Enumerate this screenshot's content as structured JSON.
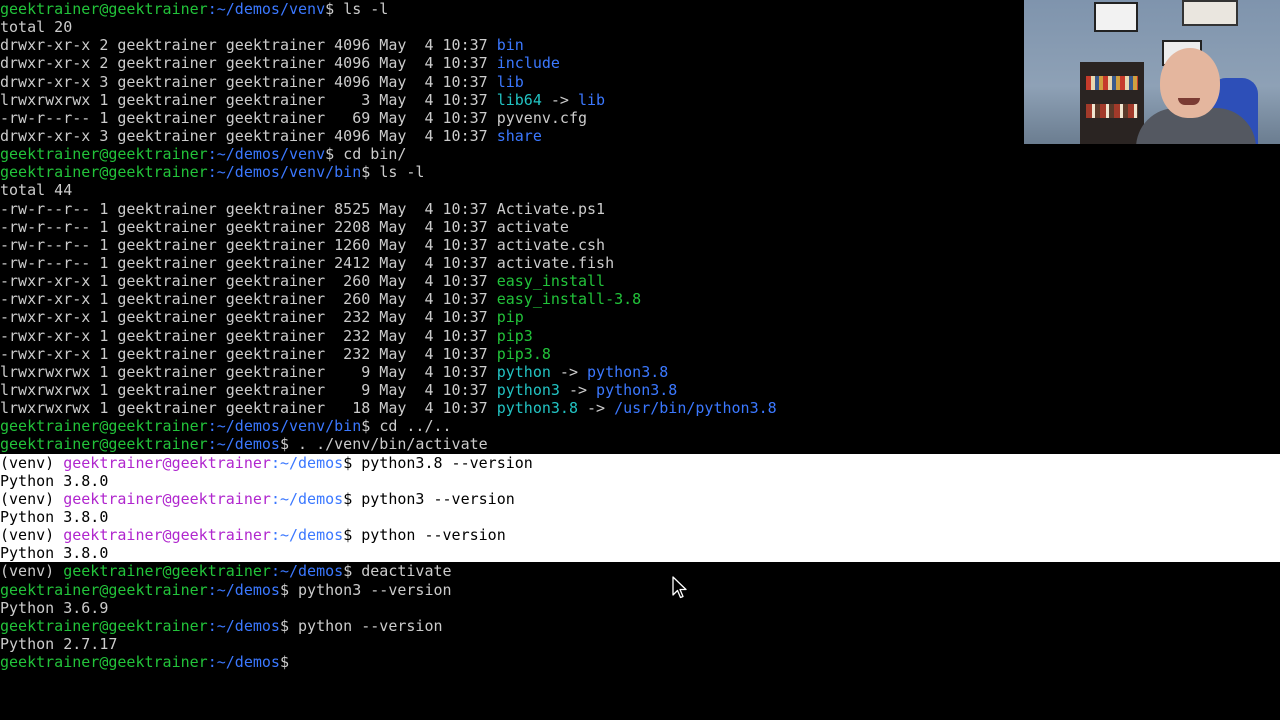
{
  "prompt": {
    "user": "geektrainer@geektrainer",
    "venv": "(venv) ",
    "suffix": "$ "
  },
  "lines": [
    {
      "path": ":~/demos/venv",
      "cmd": "ls -l"
    },
    {
      "text": "total 20"
    },
    {
      "perm": "drwxr-xr-x 2 geektrainer geektrainer 4096 May  4 10:37 ",
      "name": "bin",
      "kind": "dir"
    },
    {
      "perm": "drwxr-xr-x 2 geektrainer geektrainer 4096 May  4 10:37 ",
      "name": "include",
      "kind": "dir"
    },
    {
      "perm": "drwxr-xr-x 3 geektrainer geektrainer 4096 May  4 10:37 ",
      "name": "lib",
      "kind": "dir"
    },
    {
      "perm": "lrwxrwxrwx 1 geektrainer geektrainer    3 May  4 10:37 ",
      "name": "lib64",
      "kind": "lnk",
      "target": "lib"
    },
    {
      "perm": "-rw-r--r-- 1 geektrainer geektrainer   69 May  4 10:37 ",
      "name": "pyvenv.cfg",
      "kind": "file"
    },
    {
      "perm": "drwxr-xr-x 3 geektrainer geektrainer 4096 May  4 10:37 ",
      "name": "share",
      "kind": "dir"
    },
    {
      "path": ":~/demos/venv",
      "cmd": "cd bin/"
    },
    {
      "path": ":~/demos/venv/bin",
      "cmd": "ls -l"
    },
    {
      "text": "total 44"
    },
    {
      "perm": "-rw-r--r-- 1 geektrainer geektrainer 8525 May  4 10:37 ",
      "name": "Activate.ps1",
      "kind": "file"
    },
    {
      "perm": "-rw-r--r-- 1 geektrainer geektrainer 2208 May  4 10:37 ",
      "name": "activate",
      "kind": "file"
    },
    {
      "perm": "-rw-r--r-- 1 geektrainer geektrainer 1260 May  4 10:37 ",
      "name": "activate.csh",
      "kind": "file"
    },
    {
      "perm": "-rw-r--r-- 1 geektrainer geektrainer 2412 May  4 10:37 ",
      "name": "activate.fish",
      "kind": "file"
    },
    {
      "perm": "-rwxr-xr-x 1 geektrainer geektrainer  260 May  4 10:37 ",
      "name": "easy_install",
      "kind": "exe"
    },
    {
      "perm": "-rwxr-xr-x 1 geektrainer geektrainer  260 May  4 10:37 ",
      "name": "easy_install-3.8",
      "kind": "exe"
    },
    {
      "perm": "-rwxr-xr-x 1 geektrainer geektrainer  232 May  4 10:37 ",
      "name": "pip",
      "kind": "exe"
    },
    {
      "perm": "-rwxr-xr-x 1 geektrainer geektrainer  232 May  4 10:37 ",
      "name": "pip3",
      "kind": "exe"
    },
    {
      "perm": "-rwxr-xr-x 1 geektrainer geektrainer  232 May  4 10:37 ",
      "name": "pip3.8",
      "kind": "exe"
    },
    {
      "perm": "lrwxrwxrwx 1 geektrainer geektrainer    9 May  4 10:37 ",
      "name": "python",
      "kind": "lnk",
      "target": "python3.8"
    },
    {
      "perm": "lrwxrwxrwx 1 geektrainer geektrainer    9 May  4 10:37 ",
      "name": "python3",
      "kind": "lnk",
      "target": "python3.8"
    },
    {
      "perm": "lrwxrwxrwx 1 geektrainer geektrainer   18 May  4 10:37 ",
      "name": "python3.8",
      "kind": "lnk",
      "target": "/usr/bin/python3.8"
    },
    {
      "path": ":~/demos/venv/bin",
      "cmd": "cd ../.."
    },
    {
      "path": ":~/demos",
      "cmd": ". ./venv/bin/activate"
    },
    {
      "venv": true,
      "path": ":~/demos",
      "cmd": "python3.8 --version",
      "hl": true
    },
    {
      "text": "Python 3.8.0",
      "hl": true
    },
    {
      "venv": true,
      "path": ":~/demos",
      "cmd": "python3 --version",
      "hl": true
    },
    {
      "text": "Python 3.8.0",
      "hl": true
    },
    {
      "venv": true,
      "path": ":~/demos",
      "cmd": "python --version",
      "hl": true
    },
    {
      "text": "Python 3.8.0",
      "hl": true
    },
    {
      "venv": true,
      "path": ":~/demos",
      "cmd": "deactivate"
    },
    {
      "path": ":~/demos",
      "cmd": "python3 --version"
    },
    {
      "text": "Python 3.6.9"
    },
    {
      "path": ":~/demos",
      "cmd": "python --version"
    },
    {
      "text": "Python 2.7.17"
    },
    {
      "path": ":~/demos",
      "cmd": ""
    }
  ],
  "link_arrow": " -> ",
  "icons": {
    "cursor": "mouse-pointer-icon"
  }
}
